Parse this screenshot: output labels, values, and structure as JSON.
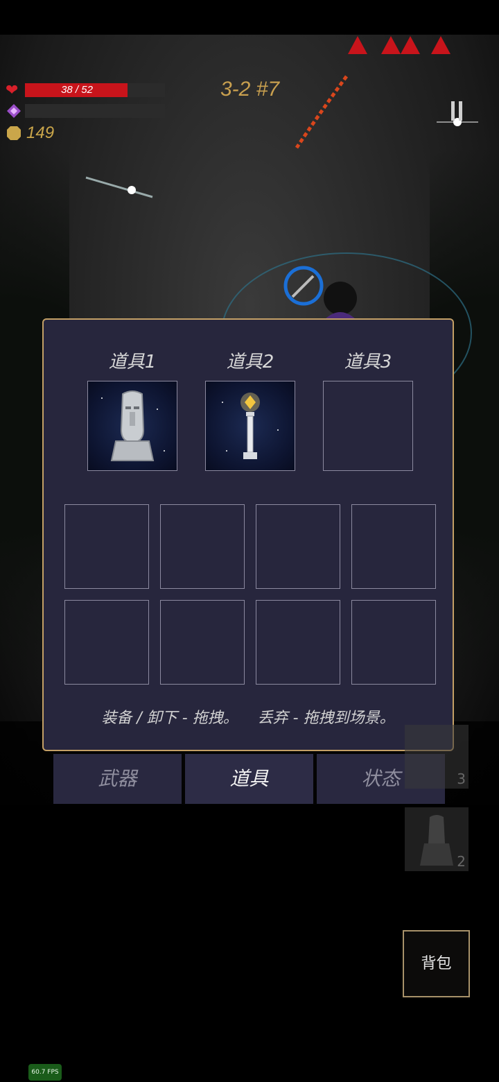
{
  "hud": {
    "hp_text": "38 / 52",
    "hp_fraction": 0.7308,
    "mp_fraction": 0.0,
    "gold": "149",
    "stage": "3-2 #7",
    "icons": {
      "heart": "heart-icon",
      "gem": "gem-icon",
      "coin": "coin-icon",
      "pause": "pause-icon"
    }
  },
  "panel": {
    "equip_labels": [
      "道具1",
      "道具2",
      "道具3"
    ],
    "equip_items": [
      "moai-statue-icon",
      "glowing-pillar-icon",
      ""
    ],
    "hint": "装备 / 卸下 - 拖拽。    丢弃 - 拖拽到场景。"
  },
  "tabs": [
    "武器",
    "道具",
    "状态"
  ],
  "active_tab": "道具",
  "side_cards": [
    {
      "count": "3"
    },
    {
      "count": "2"
    }
  ],
  "bag_button": "背包",
  "fps": "60.7 FPS",
  "colors": {
    "hp": "#c8141b",
    "gold": "#caa64a",
    "panel_bg": "#27263d",
    "panel_border": "#c4a066"
  }
}
